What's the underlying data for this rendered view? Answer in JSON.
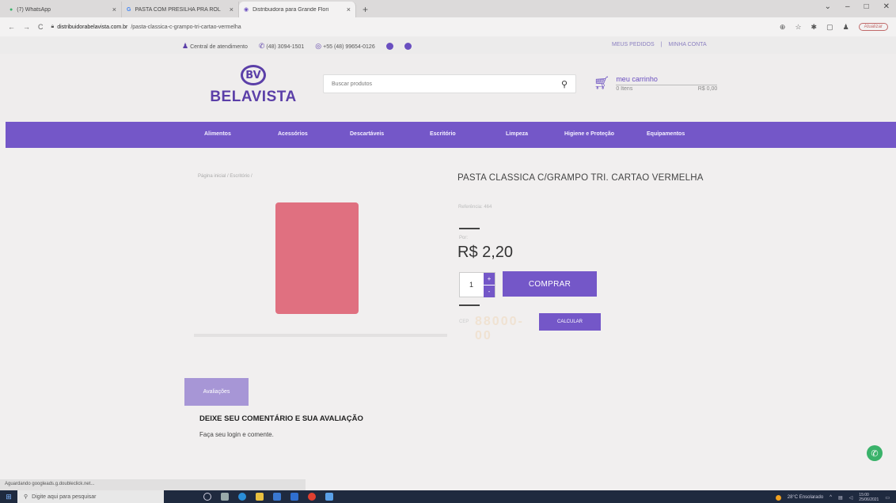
{
  "browser": {
    "tabs": [
      {
        "label": "(7) WhatsApp",
        "icon": "whatsapp-icon",
        "active": false
      },
      {
        "label": "PASTA COM PRESILHA PRA ROL",
        "icon": "google-icon",
        "active": false
      },
      {
        "label": "Distribuidora para Grande Flori",
        "icon": "site-icon",
        "active": true
      }
    ],
    "new_tab": "+",
    "url_domain": "distribuidorabelavista.com.br",
    "url_path": "/pasta-classica-c-grampo-tri-cartao-vermelha",
    "atualizar_label": "Atualizar"
  },
  "infobar": {
    "central": "Central de atendimento",
    "phone": "(48) 3094-1501",
    "whatsapp": "+55 (48) 99654-0126",
    "meus_pedidos": "MEUS PEDIDOS",
    "separator": "|",
    "minha_conta": "MINHA CONTA"
  },
  "header": {
    "logo_mark": "BV",
    "logo_text": "BELAVISTA",
    "search_placeholder": "Buscar produtos",
    "cart_title": "meu carrinho",
    "cart_items": "0 Itens",
    "cart_total": "R$ 0,00"
  },
  "nav": {
    "items": [
      "Alimentos",
      "Acessórios",
      "Descartáveis",
      "Escritório",
      "Limpeza",
      "Higiene e Proteção",
      "Equipamentos"
    ]
  },
  "product": {
    "breadcrumb": "Página inicial / Escritório /",
    "title": "PASTA CLASSICA C/GRAMPO TRI. CARTAO VERMELHA",
    "ref": "Referência: 464",
    "price_label": "Por:",
    "price": "R$ 2,20",
    "quantity": "1",
    "buy_label": "COMPRAR",
    "cep_label": "CEP",
    "cep_value": "88000-00",
    "calc_label": "CALCULAR"
  },
  "reviews": {
    "tab_label": "Avaliações",
    "title": "DEIXE SEU COMENTÁRIO E SUA AVALIAÇÃO",
    "subtitle": "Faça seu login e comente."
  },
  "status": {
    "text": "Aguardando googleads.g.doubleclick.net..."
  },
  "taskbar": {
    "search_placeholder": "Digite aqui para pesquisar",
    "weather": "28°C Ensolarado",
    "time": "15:00",
    "date": "25/06/2021"
  },
  "colors": {
    "brand_purple": "#7457c8",
    "product_red": "#e07080",
    "whatsapp_green": "#3ab26a"
  }
}
